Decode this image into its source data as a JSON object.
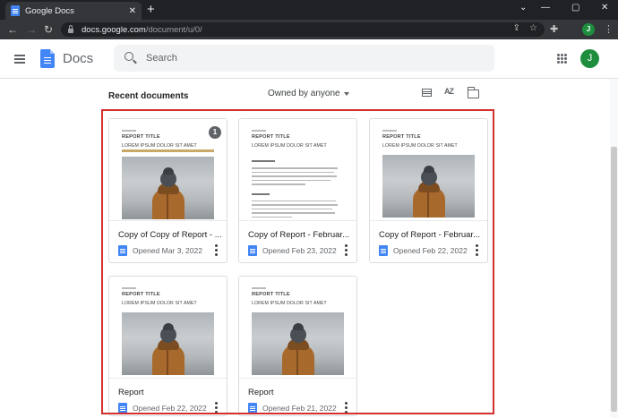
{
  "browser": {
    "tab_title": "Google Docs",
    "tab_close": "✕",
    "new_tab": "+",
    "url_host": "docs.google.com",
    "url_path": "/document/u/0/",
    "profile_initial": "J",
    "window_controls": [
      "⌄",
      "—",
      "▢",
      "✕"
    ]
  },
  "header": {
    "app_name": "Docs",
    "search_placeholder": "Search",
    "avatar_initial": "J"
  },
  "toolbar": {
    "section_title": "Recent documents",
    "owner_filter": "Owned by anyone",
    "sort_label": "AZ"
  },
  "documents": [
    {
      "title": "Copy of Copy of Report - ...",
      "opened": "Opened Mar 3, 2022",
      "badge": "1",
      "thumb": {
        "heading": "REPORT TITLE",
        "subheading": "LOREM IPSUM DOLOR SIT AMET",
        "style": "photo"
      }
    },
    {
      "title": "Copy of Report - Februar...",
      "opened": "Opened Feb 23, 2022",
      "thumb": {
        "heading": "REPORT TITLE",
        "subheading": "LOREM IPSUM DOLOR SIT AMET",
        "style": "text"
      }
    },
    {
      "title": "Copy of Report - Februar...",
      "opened": "Opened Feb 22, 2022",
      "thumb": {
        "heading": "REPORT TITLE",
        "subheading": "LOREM IPSUM DOLOR SIT AMET",
        "style": "photo"
      }
    },
    {
      "title": "Report",
      "opened": "Opened Feb 22, 2022",
      "thumb": {
        "heading": "REPORT TITLE",
        "subheading": "LOREM IPSUM DOLOR SIT AMET",
        "style": "photo"
      }
    },
    {
      "title": "Report",
      "opened": "Opened Feb 21, 2022",
      "thumb": {
        "heading": "REPORT TITLE",
        "subheading": "LOREM IPSUM DOLOR SIT AMET",
        "style": "photo"
      }
    }
  ],
  "colors": {
    "docs_blue": "#4285f4",
    "highlight_red": "#d32f2f",
    "avatar_green": "#1e8e3e"
  }
}
